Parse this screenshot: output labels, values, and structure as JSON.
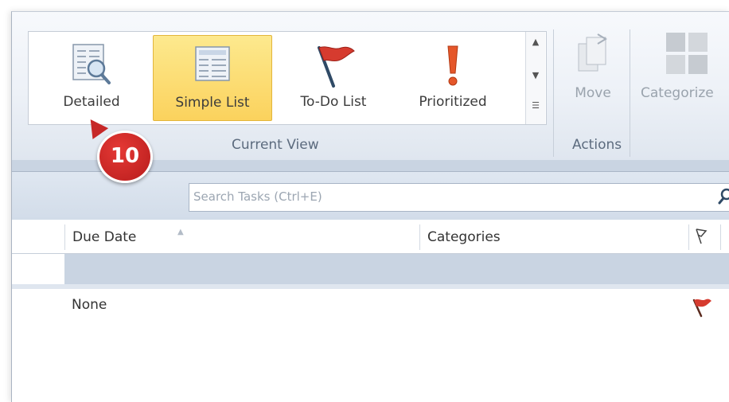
{
  "ribbon": {
    "current_view": {
      "group_label": "Current View",
      "items": [
        {
          "label": "Detailed",
          "icon": "detailed-view-icon",
          "selected": false
        },
        {
          "label": "Simple List",
          "icon": "simple-list-icon",
          "selected": true
        },
        {
          "label": "To-Do List",
          "icon": "todo-flag-icon",
          "selected": false
        },
        {
          "label": "Prioritized",
          "icon": "priority-exclamation-icon",
          "selected": false
        }
      ]
    },
    "actions": {
      "group_label": "Actions",
      "move_label": "Move"
    },
    "categorize_label": "Categorize"
  },
  "callout": {
    "number": "10",
    "color": "#c62828"
  },
  "search": {
    "placeholder": "Search Tasks (Ctrl+E)"
  },
  "table": {
    "columns": [
      "Due Date",
      "Categories"
    ],
    "rows": [
      {
        "due_date": "None",
        "flag": "red-flag-icon"
      }
    ]
  },
  "colors": {
    "selected_gradient": "#fbd25d",
    "accent_red": "#d32f2f"
  }
}
